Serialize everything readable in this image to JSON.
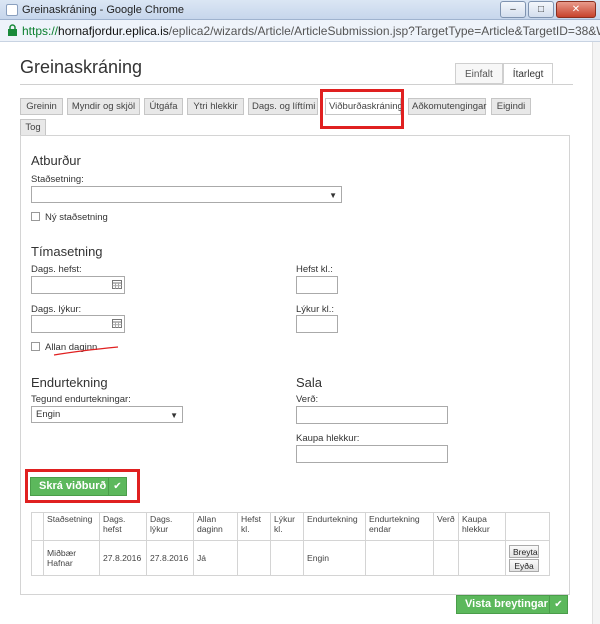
{
  "window": {
    "title": "Greinaskráning - Google Chrome",
    "minimize_label": "–",
    "maximize_label": "□",
    "close_label": "✕"
  },
  "url": {
    "scheme": "https://",
    "host": "hornafjordur.eplica.is",
    "path": "/eplica2/wizards/Article/ArticleSubmission.jsp?TargetType=Article&TargetID=38&WS"
  },
  "page": {
    "title": "Greinaskráning",
    "modes": [
      "Einfalt",
      "Ítarlegt"
    ]
  },
  "tabs": [
    "Greinin",
    "Myndir og skjöl",
    "Útgáfa",
    "Ytri hlekkir",
    "Dags. og líftími",
    "Viðburðaskráning",
    "Aðkomutengingar",
    "Eigindi",
    "Tog"
  ],
  "event": {
    "section_title": "Atburður",
    "location_label": "Staðsetning:",
    "location_value": "",
    "new_location_label": "Ný staðsetning"
  },
  "time": {
    "section_title": "Tímasetning",
    "start_date_label": "Dags. hefst:",
    "end_date_label": "Dags. lýkur:",
    "start_time_label": "Hefst kl.:",
    "end_time_label": "Lýkur kl.:",
    "all_day_label": "Allan daginn"
  },
  "recurrence": {
    "section_title": "Endurtekning",
    "type_label": "Tegund endurtekningar:",
    "type_value": "Engin"
  },
  "sales": {
    "section_title": "Sala",
    "price_label": "Verð:",
    "buy_link_label": "Kaupa hlekkur:"
  },
  "register_button": "Skrá viðburð",
  "table": {
    "headers": [
      "Staðsetning",
      "Dags. hefst",
      "Dags. lýkur",
      "Allan daginn",
      "Hefst kl.",
      "Lýkur kl.",
      "Endurtekning",
      "Endurtekning endar",
      "Verð",
      "Kaupa hlekkur"
    ],
    "rows": [
      {
        "location": "Miðbær Hafnar",
        "start": "27.8.2016",
        "end": "27.8.2016",
        "all_day": "Já",
        "start_time": "",
        "end_time": "",
        "recurrence": "Engin",
        "recurrence_end": "",
        "price": "",
        "buy_link": "",
        "edit": "Breyta",
        "delete": "Eyða"
      }
    ]
  },
  "save_button": "Vista breytingar",
  "colors": {
    "accent_green": "#5cb85c",
    "highlight_red": "#e02020"
  }
}
